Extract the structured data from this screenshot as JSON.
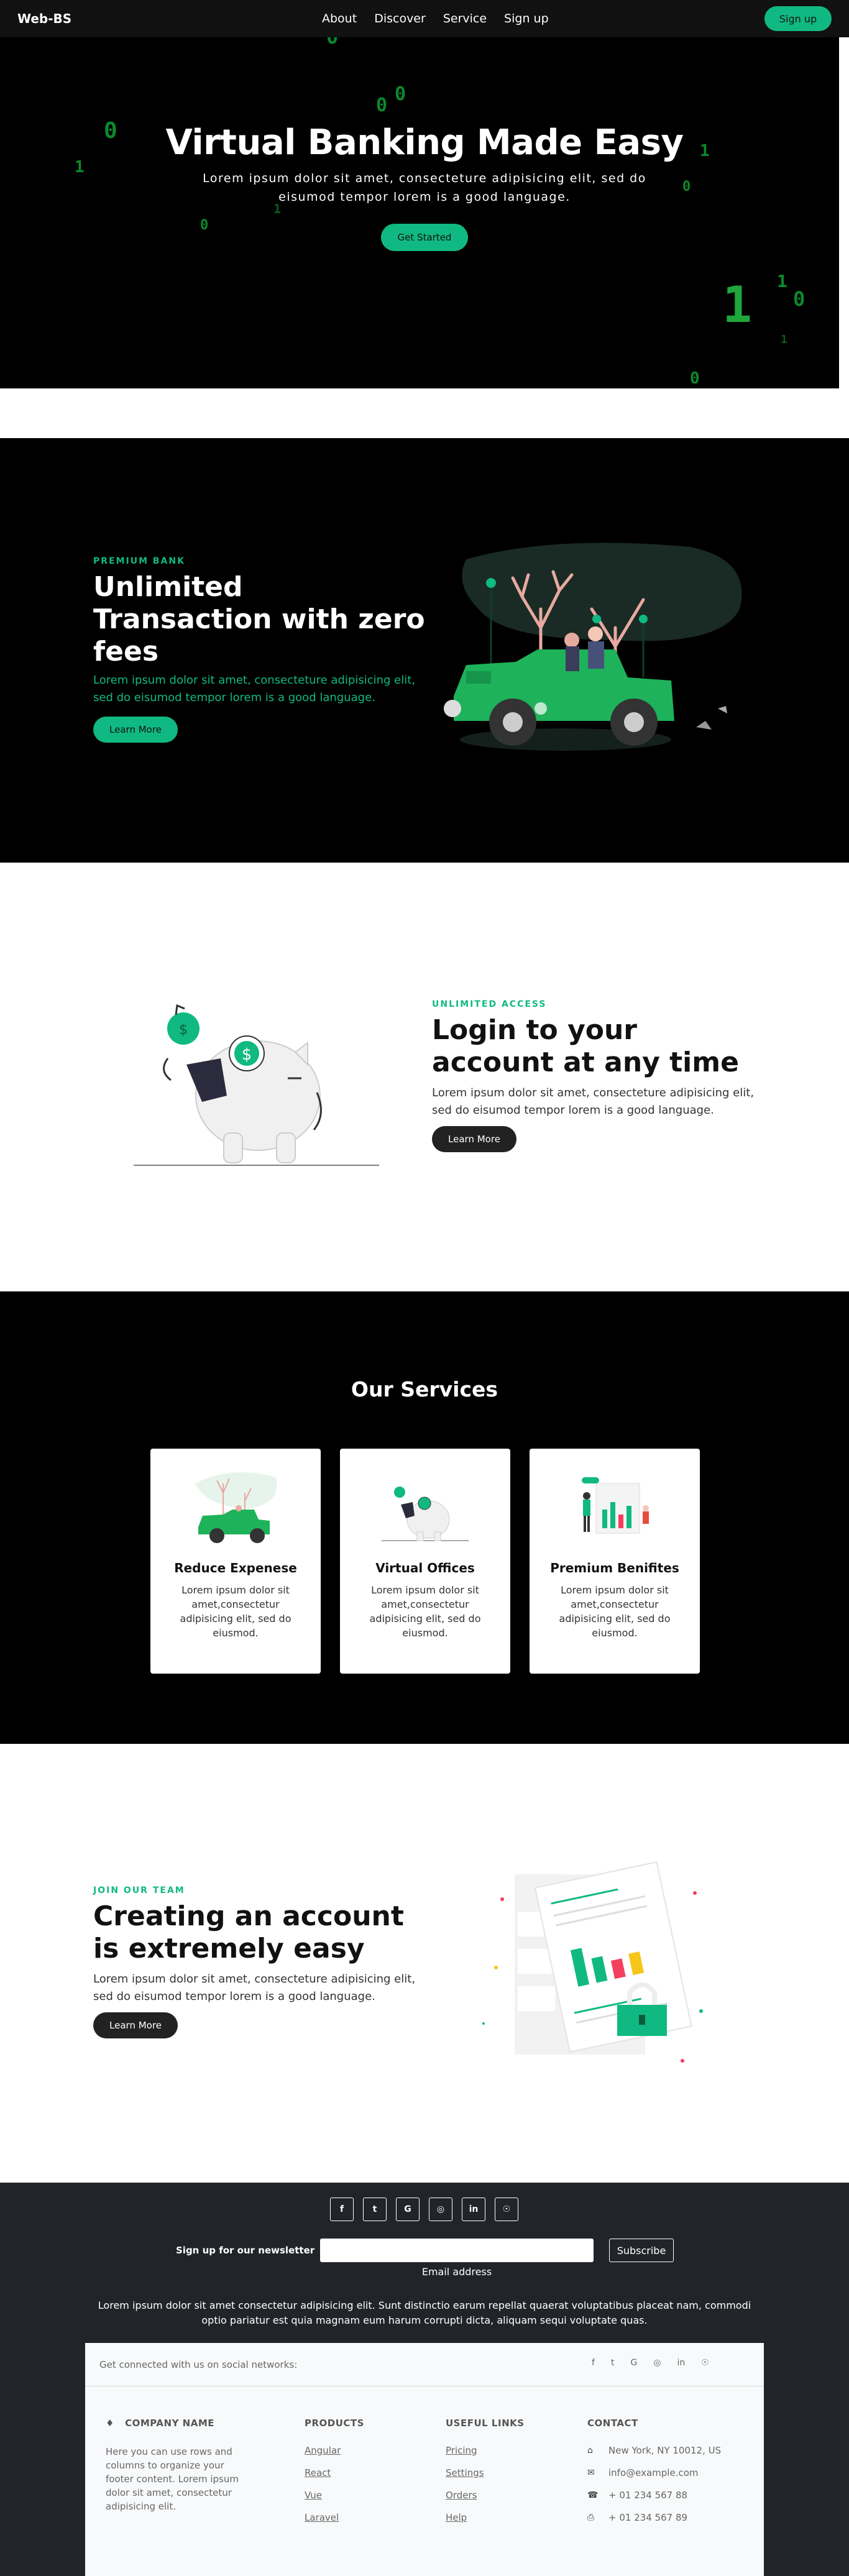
{
  "navbar": {
    "brand": "Web-BS",
    "links": [
      "About",
      "Discover",
      "Service",
      "Sign up"
    ],
    "signup_button": "Sign up"
  },
  "hero": {
    "title": "Virtual Banking Made Easy",
    "subtitle": "Lorem ipsum dolor sit amet, consecteture adipisicing elit, sed do eisumod tempor lorem is a good language.",
    "cta": "Get Started"
  },
  "section_unlimited": {
    "eyebrow": "PREMIUM BANK",
    "title": "Unlimited Transaction with zero fees",
    "text": "Lorem ipsum dolor sit amet, consecteture adipisicing elit, sed do eisumod tempor lorem is a good language.",
    "button": "Learn More"
  },
  "section_login": {
    "eyebrow": "UNLIMITED ACCESS",
    "title": "Login to your account at any time",
    "text": "Lorem ipsum dolor sit amet, consecteture adipisicing elit, sed do eisumod tempor lorem is a good language.",
    "button": "Learn More"
  },
  "services": {
    "title": "Our Services",
    "cards": [
      {
        "title": "Reduce Expenese",
        "text": "Lorem ipsum dolor sit amet,consectetur adipisicing elit, sed do eiusmod."
      },
      {
        "title": "Virtual Offices",
        "text": "Lorem ipsum dolor sit amet,consectetur adipisicing elit, sed do eiusmod."
      },
      {
        "title": "Premium Benifites",
        "text": "Lorem ipsum dolor sit amet,consectetur adipisicing elit, sed do eiusmod."
      }
    ]
  },
  "section_account": {
    "eyebrow": "JOIN OUR TEAM",
    "title": "Creating an account is extremely easy",
    "text": "Lorem ipsum dolor sit amet, consecteture adipisicing elit, sed do eisumod tempor lorem is a good language.",
    "button": "Learn More"
  },
  "footer": {
    "socials": [
      "facebook-icon",
      "twitter-icon",
      "google-icon",
      "instagram-icon",
      "linkedin-icon",
      "github-icon"
    ],
    "newsletter_label": "Sign up for our newsletter",
    "email_label": "Email address",
    "email_value": "",
    "subscribe": "Subscribe",
    "text": "Lorem ipsum dolor sit amet consectetur adipisicing elit. Sunt distinctio earum repellat quaerat voluptatibus placeat nam, commodi optio pariatur est quia magnam eum harum corrupti dicta, aliquam sequi voluptate quas.",
    "connect_label": "Get connected with us on social networks:",
    "company": {
      "title": "COMPANY NAME",
      "text": "Here you can use rows and columns to organize your footer content. Lorem ipsum dolor sit amet, consectetur adipisicing elit."
    },
    "products": {
      "title": "PRODUCTS",
      "items": [
        "Angular",
        "React",
        "Vue",
        "Laravel"
      ]
    },
    "useful_links": {
      "title": "USEFUL LINKS",
      "items": [
        "Pricing",
        "Settings",
        "Orders",
        "Help"
      ]
    },
    "contact": {
      "title": "CONTACT",
      "address": "New York, NY 10012, US",
      "email": "info@example.com",
      "phone": "+ 01 234 567 88",
      "fax": "+ 01 234 567 89"
    }
  },
  "colors": {
    "accent": "#10b981",
    "dark": "#000000",
    "footer_bg": "#212529"
  }
}
